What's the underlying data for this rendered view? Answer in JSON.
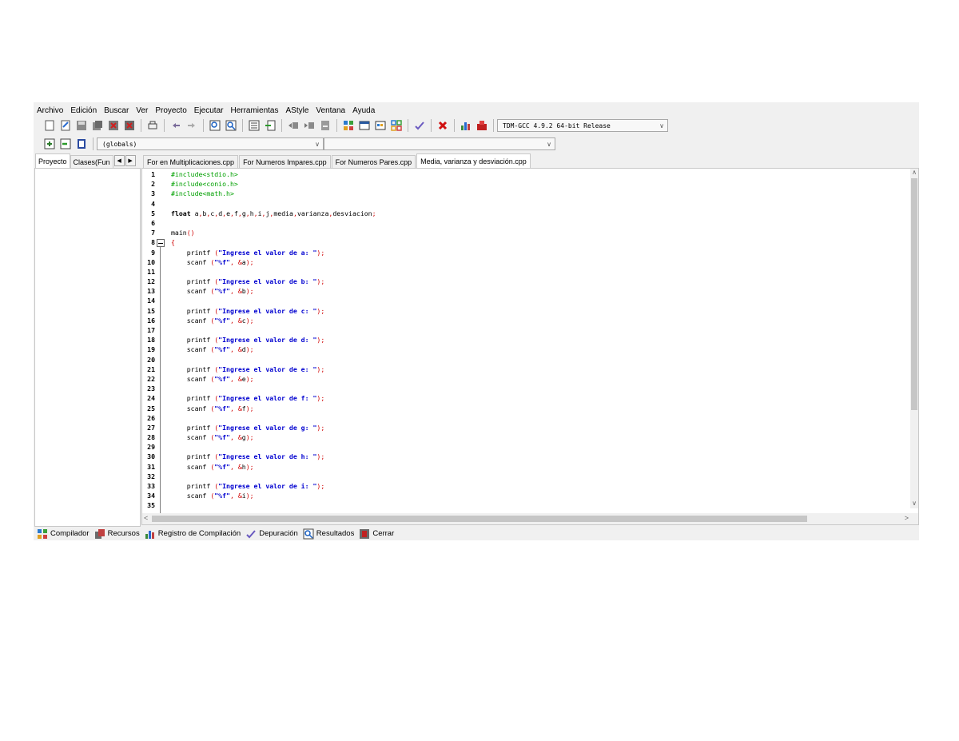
{
  "menu": [
    "Archivo",
    "Edición",
    "Buscar",
    "Ver",
    "Proyecto",
    "Ejecutar",
    "Herramientas",
    "AStyle",
    "Ventana",
    "Ayuda"
  ],
  "toolbar": {
    "compiler_select": "TDM-GCC 4.9.2 64-bit Release",
    "scope_select": "(globals)"
  },
  "left_tabs": [
    "Proyecto",
    "Clases(Fun"
  ],
  "file_tabs": [
    "For en Multiplicaciones.cpp",
    "For Numeros Impares.cpp",
    "For Numeros Pares.cpp",
    "Media, varianza y desviación.cpp"
  ],
  "code": {
    "lines": [
      {
        "n": "1",
        "text": "#include<stdio.h>"
      },
      {
        "n": "2",
        "text": "#include<conio.h>"
      },
      {
        "n": "3",
        "text": "#include<math.h>"
      },
      {
        "n": "4",
        "text": ""
      },
      {
        "n": "5",
        "text": "float a,b,c,d,e,f,g,h,i,j,media,varianza,desviacion;"
      },
      {
        "n": "6",
        "text": ""
      },
      {
        "n": "7",
        "text": "main()"
      },
      {
        "n": "8",
        "text": "{"
      },
      {
        "n": "9",
        "text": "    printf (\"Ingrese el valor de a: \");"
      },
      {
        "n": "10",
        "text": "    scanf (\"%f\", &a);"
      },
      {
        "n": "11",
        "text": ""
      },
      {
        "n": "12",
        "text": "    printf (\"Ingrese el valor de b: \");"
      },
      {
        "n": "13",
        "text": "    scanf (\"%f\", &b);"
      },
      {
        "n": "14",
        "text": ""
      },
      {
        "n": "15",
        "text": "    printf (\"Ingrese el valor de c: \");"
      },
      {
        "n": "16",
        "text": "    scanf (\"%f\", &c);"
      },
      {
        "n": "17",
        "text": ""
      },
      {
        "n": "18",
        "text": "    printf (\"Ingrese el valor de d: \");"
      },
      {
        "n": "19",
        "text": "    scanf (\"%f\", &d);"
      },
      {
        "n": "20",
        "text": ""
      },
      {
        "n": "21",
        "text": "    printf (\"Ingrese el valor de e: \");"
      },
      {
        "n": "22",
        "text": "    scanf (\"%f\", &e);"
      },
      {
        "n": "23",
        "text": ""
      },
      {
        "n": "24",
        "text": "    printf (\"Ingrese el valor de f: \");"
      },
      {
        "n": "25",
        "text": "    scanf (\"%f\", &f);"
      },
      {
        "n": "26",
        "text": ""
      },
      {
        "n": "27",
        "text": "    printf (\"Ingrese el valor de g: \");"
      },
      {
        "n": "28",
        "text": "    scanf (\"%f\", &g);"
      },
      {
        "n": "29",
        "text": ""
      },
      {
        "n": "30",
        "text": "    printf (\"Ingrese el valor de h: \");"
      },
      {
        "n": "31",
        "text": "    scanf (\"%f\", &h);"
      },
      {
        "n": "32",
        "text": ""
      },
      {
        "n": "33",
        "text": "    printf (\"Ingrese el valor de i: \");"
      },
      {
        "n": "34",
        "text": "    scanf (\"%f\", &i);"
      },
      {
        "n": "35",
        "text": ""
      }
    ]
  },
  "bottom_tabs": [
    {
      "label": "Compilador",
      "icon": "compiler-grid-icon"
    },
    {
      "label": "Recursos",
      "icon": "resources-icon"
    },
    {
      "label": "Registro de Compilación",
      "icon": "compile-log-chart-icon"
    },
    {
      "label": "Depuración",
      "icon": "debug-check-icon"
    },
    {
      "label": "Resultados",
      "icon": "results-search-icon"
    },
    {
      "label": "Cerrar",
      "icon": "close-panel-icon"
    }
  ],
  "colors": {
    "preprocessor": "#00a000",
    "string": "#0000d0",
    "symbol": "#d00000"
  }
}
